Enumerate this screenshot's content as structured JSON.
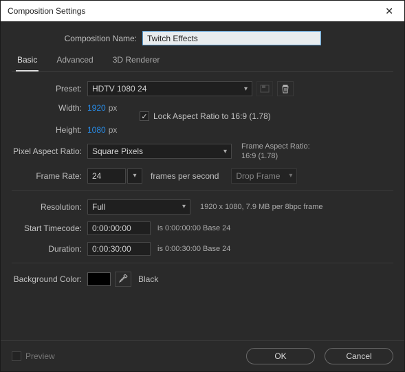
{
  "title": "Composition Settings",
  "comp_name_label": "Composition Name:",
  "comp_name_value": "Twitch Effects",
  "tabs": {
    "basic": "Basic",
    "advanced": "Advanced",
    "renderer": "3D Renderer"
  },
  "preset": {
    "label": "Preset:",
    "value": "HDTV 1080 24"
  },
  "width": {
    "label": "Width:",
    "value": "1920",
    "unit": "px"
  },
  "height": {
    "label": "Height:",
    "value": "1080",
    "unit": "px"
  },
  "lock_aspect": {
    "label": "Lock Aspect Ratio to 16:9 (1.78)"
  },
  "par": {
    "label": "Pixel Aspect Ratio:",
    "value": "Square Pixels",
    "note_title": "Frame Aspect Ratio:",
    "note_value": "16:9 (1.78)"
  },
  "frame_rate": {
    "label": "Frame Rate:",
    "value": "24",
    "per_text": "frames per second",
    "drop_value": "Drop Frame"
  },
  "resolution": {
    "label": "Resolution:",
    "value": "Full",
    "note": "1920 x 1080, 7.9 MB per 8bpc frame"
  },
  "start_tc": {
    "label": "Start Timecode:",
    "value": "0:00:00:00",
    "note": "is 0:00:00:00  Base 24"
  },
  "duration": {
    "label": "Duration:",
    "value": "0:00:30:00",
    "note": "is 0:00:30:00  Base 24"
  },
  "bg": {
    "label": "Background Color:",
    "name": "Black",
    "hex": "#000000"
  },
  "preview_label": "Preview",
  "buttons": {
    "ok": "OK",
    "cancel": "Cancel"
  }
}
